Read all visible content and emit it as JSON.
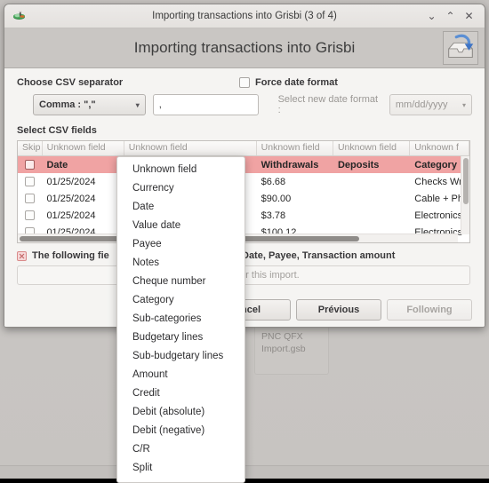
{
  "window": {
    "title": "Importing transactions into Grisbi (3 of 4)",
    "app_icon": "grisbi-icon",
    "controls": {
      "minimize": "⌄",
      "maximize": "⌃",
      "close": "✕"
    }
  },
  "banner": {
    "title": "Importing transactions into Grisbi",
    "icon": "import-inbox-icon"
  },
  "separator_section": {
    "label": "Choose CSV separator",
    "combo_value": "Comma : \",\"",
    "combo_arrow": "▾",
    "input_value": ",",
    "input_placeholder": ""
  },
  "date_section": {
    "checkbox_label": "Force date format",
    "checkbox_checked": false,
    "select_label": "Select new date format :",
    "format_value": "mm/dd/yyyy",
    "format_arrow": "▾"
  },
  "fields_section": {
    "label": "Select CSV fields",
    "headers": [
      "Skip",
      "Unknown field",
      "Unknown field",
      "Unknown field",
      "Unknown field",
      "Unknown f"
    ],
    "column_header_row": {
      "skip": "",
      "date": "Date",
      "unknown2": "",
      "withdrawals": "Withdrawals",
      "deposits": "Deposits",
      "category": "Category"
    },
    "rows": [
      {
        "date": "01/25/2024",
        "unknown2": "",
        "withdrawals": "$6.68",
        "deposits": "",
        "category": "Checks Wri"
      },
      {
        "date": "01/25/2024",
        "unknown2": "..",
        "withdrawals": "$90.00",
        "deposits": "",
        "category": "Cable + Ph"
      },
      {
        "date": "01/25/2024",
        "unknown2": "",
        "withdrawals": "$3.78",
        "deposits": "",
        "category": "Electronics"
      },
      {
        "date": "01/25/2024",
        "unknown2": "",
        "withdrawals": "$100.12",
        "deposits": "",
        "category": "Electronics"
      }
    ]
  },
  "warning": {
    "icon": "error-icon",
    "text_left": "The following fie",
    "text_right": "ent: Date, Payee, Transaction amount",
    "note_text": "for this import."
  },
  "buttons": {
    "cancel": "ancel",
    "previous": "Prévious",
    "following": "Following",
    "following_disabled": true
  },
  "popup_menu": {
    "items": [
      "Unknown field",
      "Currency",
      "Date",
      "Value date",
      "Payee",
      "Notes",
      "Cheque number",
      "Category",
      "Sub-categories",
      "Budgetary lines",
      "Sub-budgetary lines",
      "Amount",
      "Credit",
      "Debit (absolute)",
      "Debit (negative)",
      "C/R",
      "Split"
    ]
  },
  "desktop": {
    "file_tile": {
      "line1": "PNC QFX",
      "line2": "Import.gsb"
    }
  },
  "colors": {
    "header_row_pink": "#f0a3a3",
    "banner_bg": "#c9c6c3",
    "window_bg": "#f5f4f2",
    "desktop_bg": "#c9c6c3"
  }
}
